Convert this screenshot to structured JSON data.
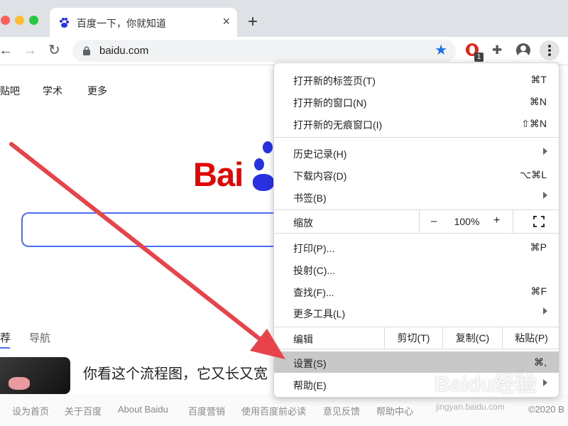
{
  "browser": {
    "tab": {
      "title": "百度一下，你就知道",
      "close": "×"
    },
    "new_tab": "+",
    "nav": {
      "back": "←",
      "forward": "→",
      "reload": "↻"
    },
    "url": "baidu.com",
    "extension_badge": "1",
    "accent_color": "#1a73e8"
  },
  "page": {
    "top_nav": [
      "贴吧",
      "学术",
      "更多"
    ],
    "logo_text": "Bai",
    "feed_tabs": [
      "荐",
      "导航"
    ],
    "feed_title": "你看这个流程图，它又长又宽",
    "footer_links": [
      "设为首页",
      "关于百度",
      "About Baidu",
      "百度营销",
      "使用百度前必读",
      "意见反馈",
      "帮助中心"
    ],
    "footer_copyright": "©2020 B"
  },
  "menu": {
    "new_tab": {
      "label": "打开新的标签页(T)",
      "shortcut": "⌘T"
    },
    "new_window": {
      "label": "打开新的窗口(N)",
      "shortcut": "⌘N"
    },
    "incognito": {
      "label": "打开新的无痕窗口(I)",
      "shortcut": "⇧⌘N"
    },
    "history": {
      "label": "历史记录(H)"
    },
    "downloads": {
      "label": "下载内容(D)",
      "shortcut": "⌥⌘L"
    },
    "bookmarks": {
      "label": "书签(B)"
    },
    "zoom": {
      "label": "缩放",
      "minus": "–",
      "value": "100%",
      "plus": "+"
    },
    "print": {
      "label": "打印(P)...",
      "shortcut": "⌘P"
    },
    "cast": {
      "label": "投射(C)..."
    },
    "find": {
      "label": "查找(F)...",
      "shortcut": "⌘F"
    },
    "more_tools": {
      "label": "更多工具(L)"
    },
    "edit": {
      "label": "编辑",
      "cut": "剪切(T)",
      "copy": "复制(C)",
      "paste": "粘贴(P)"
    },
    "settings": {
      "label": "设置(S)",
      "shortcut": "⌘,"
    },
    "help": {
      "label": "帮助(E)"
    }
  },
  "watermark": {
    "text": "Baidu经验",
    "sub": "jingyan.baidu.com"
  },
  "annotation_arrow_color": "#e8434a"
}
